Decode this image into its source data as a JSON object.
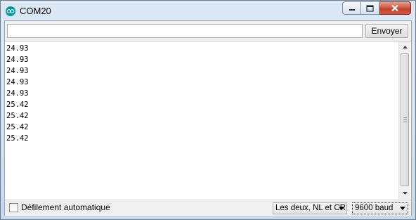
{
  "window": {
    "title": "COM20"
  },
  "toolbar": {
    "input_value": "",
    "send_label": "Envoyer"
  },
  "output": {
    "lines": [
      "24.93",
      "24.93",
      "24.93",
      "24.93",
      "24.93",
      "25.42",
      "25.42",
      "25.42",
      "25.42"
    ]
  },
  "footer": {
    "autoscroll_label": "Défilement automatique",
    "autoscroll_checked": false,
    "line_ending": "Les deux, NL et CR",
    "baud_rate": "9600 baud"
  },
  "colors": {
    "arduino_teal": "#00979c",
    "close_red": "#c5432c"
  }
}
